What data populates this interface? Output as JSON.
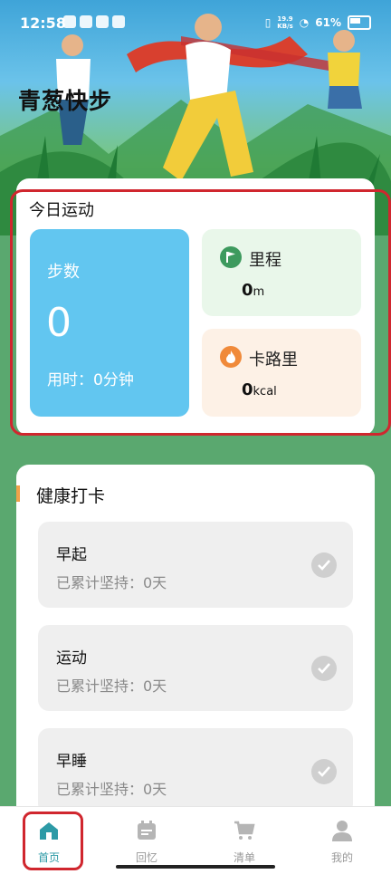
{
  "status_bar": {
    "time": "12:58",
    "net_speed_value": "19.9",
    "net_speed_unit": "KB/s",
    "battery": "61%"
  },
  "app": {
    "title": "青葱快步"
  },
  "today": {
    "title": "今日运动",
    "steps": {
      "label": "步数",
      "value": "0",
      "time_label": "用时：0分钟"
    },
    "mileage": {
      "label": "里程",
      "value": "0",
      "unit": "m"
    },
    "calories": {
      "label": "卡路里",
      "value": "0",
      "unit": "kcal"
    }
  },
  "health": {
    "title": "健康打卡",
    "items": [
      {
        "name": "早起",
        "streak": "已累计坚持：0天"
      },
      {
        "name": "运动",
        "streak": "已累计坚持：0天"
      },
      {
        "name": "早睡",
        "streak": "已累计坚持：0天"
      }
    ]
  },
  "nav": {
    "items": [
      {
        "label": "首页",
        "icon": "home-icon",
        "active": true
      },
      {
        "label": "回忆",
        "icon": "calendar-icon",
        "active": false
      },
      {
        "label": "清单",
        "icon": "cart-icon",
        "active": false
      },
      {
        "label": "我的",
        "icon": "user-icon",
        "active": false
      }
    ]
  },
  "colors": {
    "steps_tile": "#62c6f0",
    "mileage_tile": "#e9f7ea",
    "calorie_tile": "#fdf1e6",
    "nav_active": "#2c9aa6",
    "highlight": "#d0262e",
    "mileage_icon": "#3d9a5e",
    "calorie_icon": "#f08a3a"
  }
}
